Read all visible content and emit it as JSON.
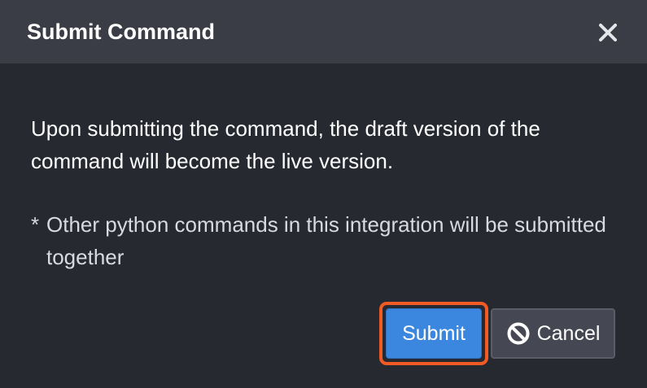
{
  "dialog": {
    "title": "Submit Command",
    "close_icon": "close-icon",
    "message": "Upon submitting the command, the draft version of the command will become the live version.",
    "note_marker": "*",
    "note": "Other python commands in this integration will be submitted together"
  },
  "actions": {
    "submit_label": "Submit",
    "cancel_label": "Cancel",
    "cancel_icon": "ban-icon"
  },
  "colors": {
    "background": "#262930",
    "header": "#3a3d46",
    "primary": "#3b87e0",
    "highlight": "#f05a24",
    "secondary": "#454852"
  }
}
